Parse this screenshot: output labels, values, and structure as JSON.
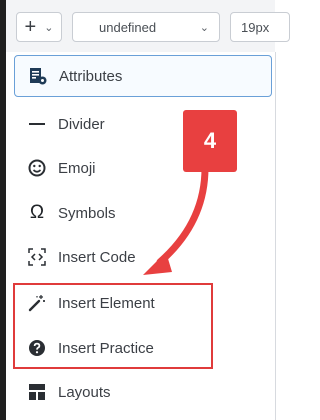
{
  "toolbar": {
    "add_icon": "plus-icon",
    "format_select_value": "undefined",
    "font_size_value": "19px"
  },
  "menu": {
    "items": [
      {
        "label": "Attributes",
        "icon": "attributes-icon"
      },
      {
        "label": "Divider",
        "icon": "divider-icon"
      },
      {
        "label": "Emoji",
        "icon": "emoji-icon"
      },
      {
        "label": "Symbols",
        "icon": "omega-icon"
      },
      {
        "label": "Insert Code",
        "icon": "code-icon"
      },
      {
        "label": "Insert Element",
        "icon": "magic-wand-icon"
      },
      {
        "label": "Insert Practice",
        "icon": "question-circle-icon"
      },
      {
        "label": "Layouts",
        "icon": "layout-icon"
      }
    ]
  },
  "annotation": {
    "step_number": "4",
    "highlight_color": "#e03b3b",
    "badge_color": "#e84040"
  }
}
